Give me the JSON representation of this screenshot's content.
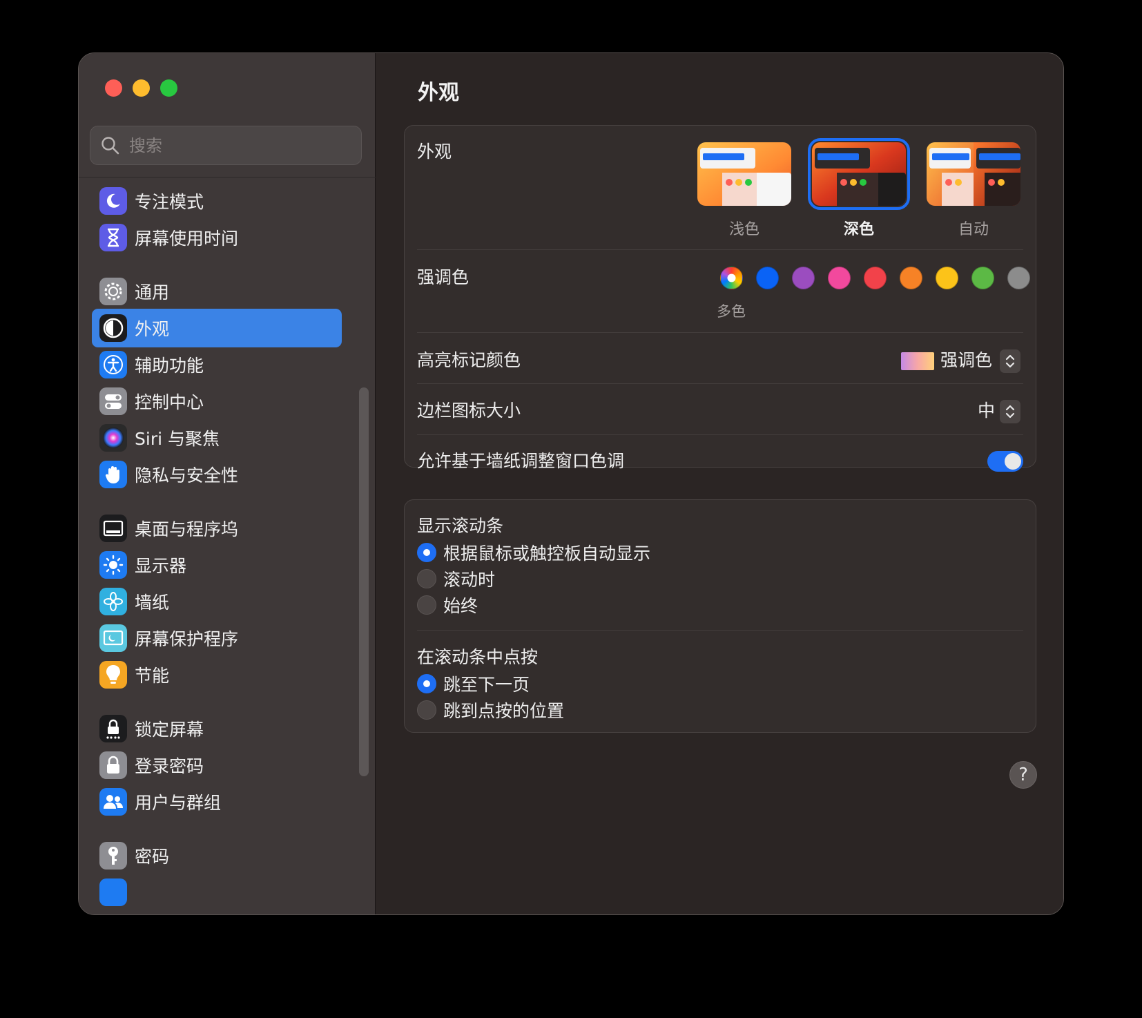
{
  "search": {
    "placeholder": "搜索"
  },
  "sidebar": {
    "items": [
      {
        "label": "专注模式",
        "icon": "moon-icon",
        "color": "#5e5ce6"
      },
      {
        "label": "屏幕使用时间",
        "icon": "hourglass-icon",
        "color": "#5e5ce6"
      },
      {
        "label": "通用",
        "icon": "gear-icon",
        "color": "#8e8e93"
      },
      {
        "label": "外观",
        "icon": "appearance-icon",
        "color": "#1c1c1e"
      },
      {
        "label": "辅助功能",
        "icon": "accessibility-icon",
        "color": "#1e7bf2"
      },
      {
        "label": "控制中心",
        "icon": "control-center-icon",
        "color": "#8e8e93"
      },
      {
        "label": "Siri 与聚焦",
        "icon": "siri-icon",
        "color": "#2a2a2a"
      },
      {
        "label": "隐私与安全性",
        "icon": "hand-icon",
        "color": "#1e7bf2"
      },
      {
        "label": "桌面与程序坞",
        "icon": "dock-icon",
        "color": "#1c1c1e"
      },
      {
        "label": "显示器",
        "icon": "sun-icon",
        "color": "#1e7bf2"
      },
      {
        "label": "墙纸",
        "icon": "flower-icon",
        "color": "#30b0e0"
      },
      {
        "label": "屏幕保护程序",
        "icon": "screensaver-icon",
        "color": "#5ac8e0"
      },
      {
        "label": "节能",
        "icon": "bulb-icon",
        "color": "#f5a623"
      },
      {
        "label": "锁定屏幕",
        "icon": "lock-screen-icon",
        "color": "#1c1c1e"
      },
      {
        "label": "登录密码",
        "icon": "lock-icon",
        "color": "#8e8e93"
      },
      {
        "label": "用户与群组",
        "icon": "users-icon",
        "color": "#1e7bf2"
      },
      {
        "label": "密码",
        "icon": "key-icon",
        "color": "#8e8e93"
      }
    ],
    "active_index": 3
  },
  "main": {
    "title": "外观",
    "appearance": {
      "label": "外观",
      "options": [
        {
          "label": "浅色",
          "selected": false
        },
        {
          "label": "深色",
          "selected": true
        },
        {
          "label": "自动",
          "selected": false
        }
      ]
    },
    "accent": {
      "label": "强调色",
      "colors": [
        "multicolor",
        "#0a63f6",
        "#9b4dbf",
        "#f2499d",
        "#f2424a",
        "#f68226",
        "#fcc319",
        "#5cb945",
        "#8c8c8c"
      ],
      "selected_caption": "多色"
    },
    "highlight": {
      "label": "高亮标记颜色",
      "value": "强调色"
    },
    "sidebar_icon_size": {
      "label": "边栏图标大小",
      "value": "中"
    },
    "wallpaper_tint": {
      "label": "允许基于墙纸调整窗口色调",
      "on": true
    },
    "scrollbars": {
      "label": "显示滚动条",
      "options": [
        {
          "label": "根据鼠标或触控板自动显示",
          "selected": true
        },
        {
          "label": "滚动时",
          "selected": false
        },
        {
          "label": "始终",
          "selected": false
        }
      ]
    },
    "click_scrollbar": {
      "label": "在滚动条中点按",
      "options": [
        {
          "label": "跳至下一页",
          "selected": true
        },
        {
          "label": "跳到点按的位置",
          "selected": false
        }
      ]
    },
    "help": "?"
  }
}
